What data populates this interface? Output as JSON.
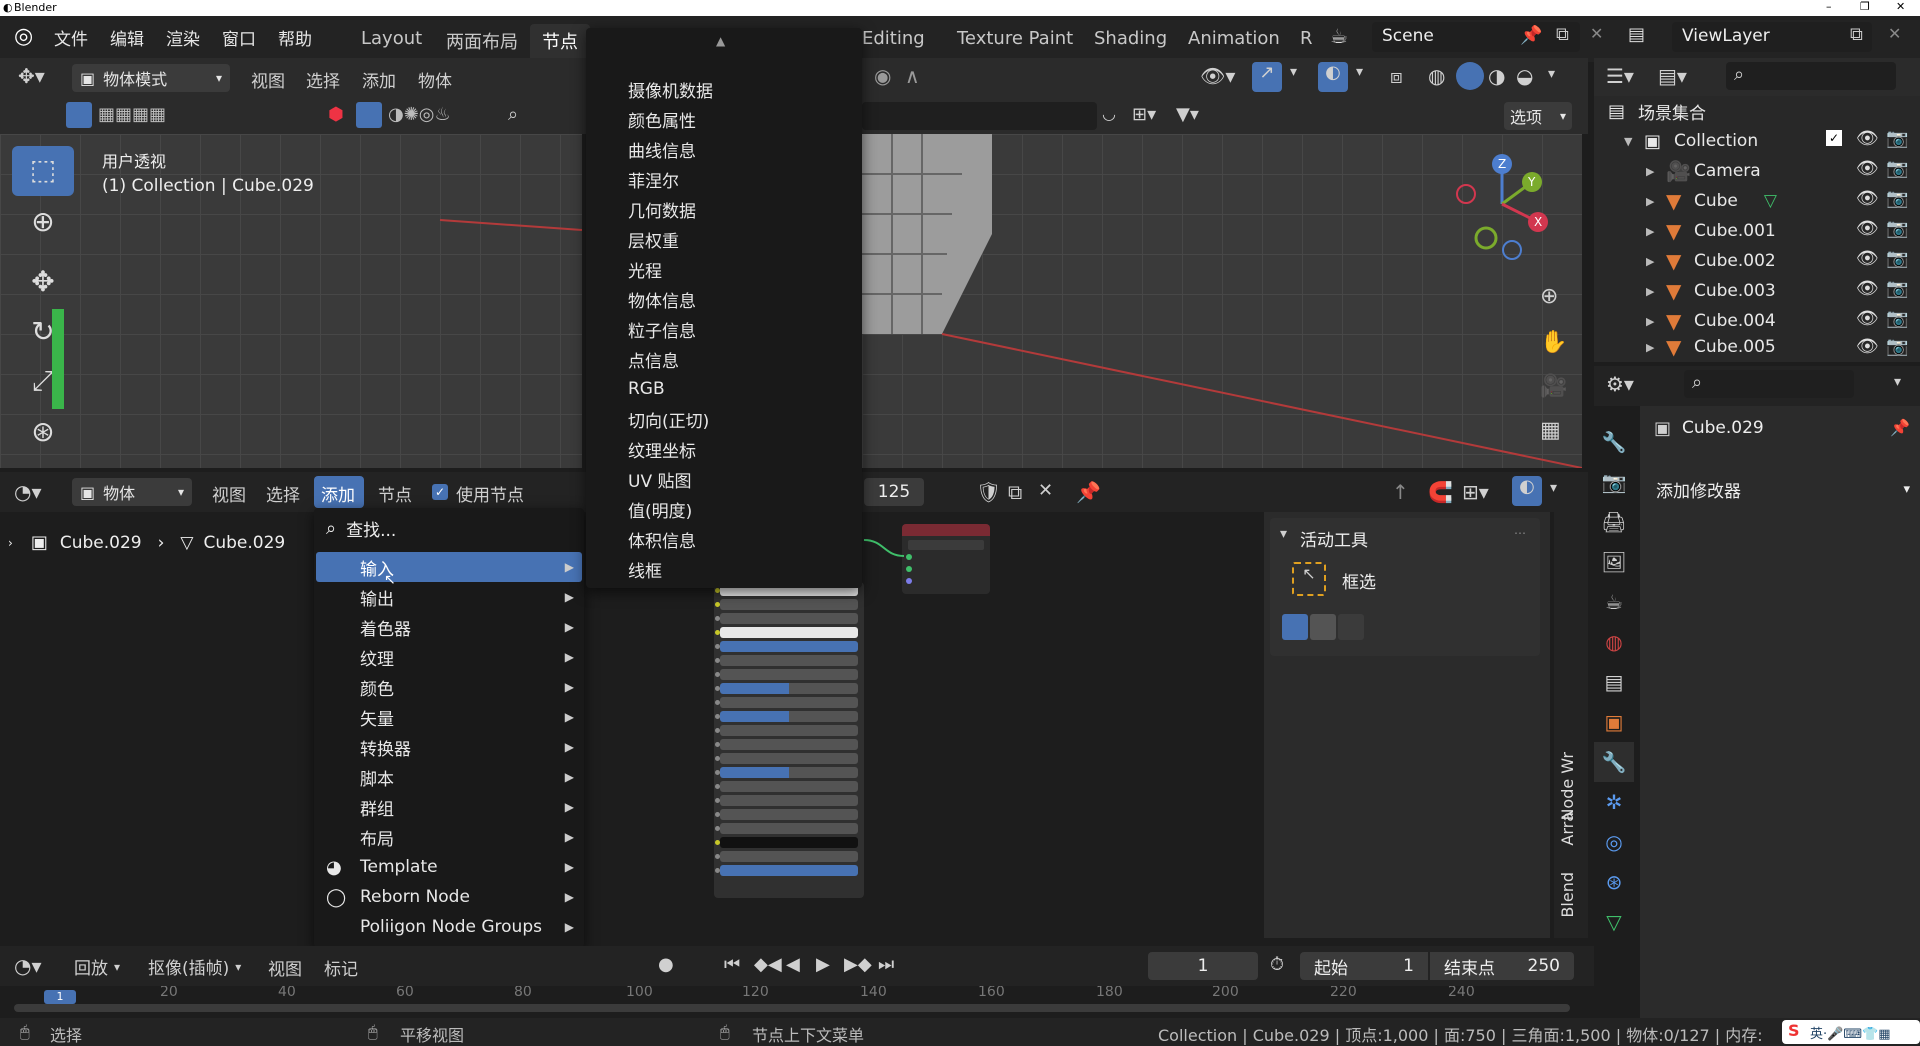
{
  "window": {
    "title": "Blender"
  },
  "topmenu": {
    "items": [
      "文件",
      "编辑",
      "渲染",
      "窗口",
      "帮助"
    ]
  },
  "workspaces": [
    "Layout",
    "两面布局",
    "节点",
    "Editing",
    "Texture Paint",
    "Shading",
    "Animation",
    "R"
  ],
  "scene": {
    "name": "Scene"
  },
  "viewlayer": {
    "name": "ViewLayer"
  },
  "viewport": {
    "mode": "物体模式",
    "menus": [
      "视图",
      "选择",
      "添加",
      "物体"
    ],
    "info_line1": "用户透视",
    "info_line2": "(1) Collection | Cube.029",
    "options_label": "选项"
  },
  "node_editor": {
    "type_label": "物体",
    "menus": [
      "视图",
      "选择",
      "添加",
      "节点"
    ],
    "use_nodes_label": "使用节点",
    "breadcrumb": [
      "Cube.029",
      "Cube.029"
    ],
    "frame_count": "125",
    "tool_panel_title": "活动工具",
    "tool_name": "框选",
    "side_tabs": [
      "Node Wr",
      "Arra",
      "Blend"
    ]
  },
  "add_menu": {
    "search_label": "查找...",
    "items": [
      {
        "label": "输入",
        "highlighted": true
      },
      {
        "label": "输出"
      },
      {
        "label": "着色器"
      },
      {
        "label": "纹理"
      },
      {
        "label": "颜色"
      },
      {
        "label": "矢量"
      },
      {
        "label": "转换器"
      },
      {
        "label": "脚本"
      },
      {
        "label": "群组"
      },
      {
        "label": "布局"
      },
      {
        "label": "Template"
      },
      {
        "label": "Reborn Node"
      },
      {
        "label": "Poliigon Node Groups"
      }
    ]
  },
  "input_submenu": {
    "items": [
      "摄像机数据",
      "颜色属性",
      "曲线信息",
      "菲涅尔",
      "几何数据",
      "层权重",
      "光程",
      "物体信息",
      "粒子信息",
      "点信息",
      "RGB",
      "切向(正切)",
      "纹理坐标",
      "UV 贴图",
      "值(明度)",
      "体积信息",
      "线框"
    ]
  },
  "outliner": {
    "root": "场景集合",
    "collection": "Collection",
    "objects": [
      "Camera",
      "Cube",
      "Cube.001",
      "Cube.002",
      "Cube.003",
      "Cube.004",
      "Cube.005"
    ]
  },
  "properties": {
    "object_name": "Cube.029",
    "add_modifier_label": "添加修改器"
  },
  "timeline": {
    "playback_label": "回放",
    "keying_label": "抠像(插帧)",
    "menus": [
      "视图",
      "标记"
    ],
    "current_frame": "1",
    "start_label": "起始",
    "start_value": "1",
    "end_label": "结束点",
    "end_value": "250",
    "ticks": [
      "1",
      "20",
      "40",
      "60",
      "80",
      "100",
      "120",
      "140",
      "160",
      "180",
      "200",
      "220",
      "240"
    ]
  },
  "statusbar": {
    "select": "选择",
    "pan": "平移视图",
    "context": "节点上下文菜单",
    "stats": "Collection | Cube.029 | 顶点:1,000 | 面:750 | 三角面:1,500 | 物体:0/127 | 内存:"
  },
  "colors": {
    "accent": "#4772b3",
    "mesh": "#e07b39",
    "collection": "#e8e8e8"
  }
}
